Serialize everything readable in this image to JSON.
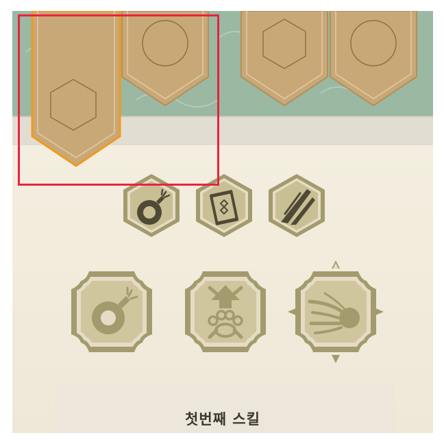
{
  "skill_panel": {
    "selected_skill_name": "첫번째 스킬"
  },
  "tabs": [
    {
      "icon": "hexagon-icon",
      "state": "selected"
    },
    {
      "icon": "circle-icon",
      "state": "normal"
    },
    {
      "icon": "hexagon-icon",
      "state": "normal"
    },
    {
      "icon": "circle-icon",
      "state": "normal"
    }
  ],
  "small_skills": [
    {
      "icon": "bomb-icon"
    },
    {
      "icon": "card-icon"
    },
    {
      "icon": "slash-icon"
    }
  ],
  "large_skills": [
    {
      "icon": "bomb-icon"
    },
    {
      "icon": "paw-arrow-icon"
    },
    {
      "icon": "comet-icon"
    }
  ],
  "colors": {
    "banner_fill": "#c9a878",
    "banner_selected_outline": "#f09a1c",
    "teal_band": "#9ab8a2",
    "icon_khaki": "#a39a6e",
    "highlight": "#e8233f"
  }
}
